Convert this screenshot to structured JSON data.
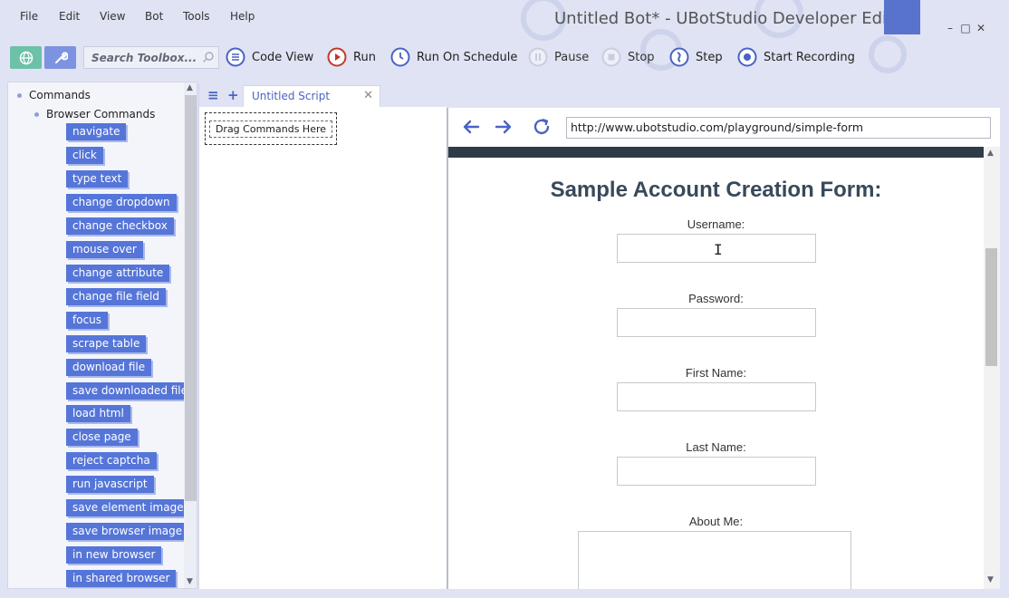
{
  "menu": [
    "File",
    "Edit",
    "View",
    "Bot",
    "Tools",
    "Help"
  ],
  "window": {
    "title": "Untitled Bot* - UBotStudio Developer Edition",
    "controls": [
      "–",
      "□",
      "✕"
    ]
  },
  "toolbar": {
    "search_placeholder": "Search Toolbox...",
    "buttons": [
      {
        "label": "Code View",
        "icon": "code-view-icon"
      },
      {
        "label": "Run",
        "icon": "run-icon"
      },
      {
        "label": "Run On Schedule",
        "icon": "schedule-icon"
      },
      {
        "label": "Pause",
        "icon": "pause-icon"
      },
      {
        "label": "Stop",
        "icon": "stop-icon"
      },
      {
        "label": "Step",
        "icon": "step-icon"
      },
      {
        "label": "Start Recording",
        "icon": "record-icon"
      }
    ]
  },
  "commands": {
    "root_label": "Commands",
    "group_label": "Browser Commands",
    "items": [
      "navigate",
      "click",
      "type text",
      "change dropdown",
      "change checkbox",
      "mouse over",
      "change attribute",
      "change file field",
      "focus",
      "scrape table",
      "download file",
      "save downloaded file",
      "load html",
      "close page",
      "reject captcha",
      "run javascript",
      "save element image",
      "save browser image",
      "in new browser",
      "in shared browser"
    ]
  },
  "script": {
    "tab_label": "Untitled Script",
    "close_glyph": "✕",
    "menu_glyph": "≡",
    "add_glyph": "+",
    "drop_hint": "Drag Commands Here"
  },
  "browser": {
    "url": "http://www.ubotstudio.com/playground/simple-form",
    "page": {
      "title": "Sample Account Creation Form:",
      "fields": [
        {
          "label": "Username:"
        },
        {
          "label": "Password:"
        },
        {
          "label": "First Name:"
        },
        {
          "label": "Last Name:"
        },
        {
          "label": "About Me:"
        }
      ]
    }
  },
  "colors": {
    "accent": "#5575d8",
    "run_red": "#c0392b",
    "icon_blue": "#4a63c4",
    "dark_bar": "#2f3c48",
    "form_title": "#38495a"
  }
}
